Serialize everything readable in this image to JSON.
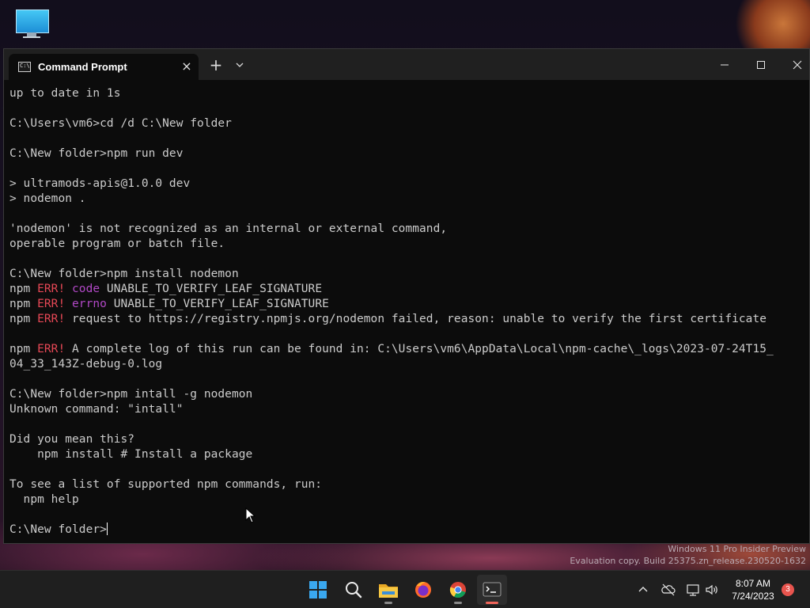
{
  "window": {
    "tab_title": "Command Prompt",
    "tab_icon_text": "C:\\",
    "close_tab_glyph": "×",
    "new_tab_glyph": "+",
    "minimize_glyph": "—",
    "maximize_glyph": "☐",
    "close_glyph": "✕"
  },
  "console": {
    "lines": [
      [
        {
          "text": "up to date in 1s"
        }
      ],
      [
        {
          "text": ""
        }
      ],
      [
        {
          "text": "C:\\Users\\vm6>cd /d C:\\New folder"
        }
      ],
      [
        {
          "text": ""
        }
      ],
      [
        {
          "text": "C:\\New folder>npm run dev"
        }
      ],
      [
        {
          "text": ""
        }
      ],
      [
        {
          "text": "> ultramods-apis@1.0.0 dev"
        }
      ],
      [
        {
          "text": "> nodemon ."
        }
      ],
      [
        {
          "text": ""
        }
      ],
      [
        {
          "text": "'nodemon' is not recognized as an internal or external command,"
        }
      ],
      [
        {
          "text": "operable program or batch file."
        }
      ],
      [
        {
          "text": ""
        }
      ],
      [
        {
          "text": "C:\\New folder>npm install nodemon"
        }
      ],
      [
        {
          "text": "npm "
        },
        {
          "text": "ERR!",
          "color": "red"
        },
        {
          "text": " "
        },
        {
          "text": "code",
          "color": "magenta"
        },
        {
          "text": " UNABLE_TO_VERIFY_LEAF_SIGNATURE"
        }
      ],
      [
        {
          "text": "npm "
        },
        {
          "text": "ERR!",
          "color": "red"
        },
        {
          "text": " "
        },
        {
          "text": "errno",
          "color": "magenta"
        },
        {
          "text": " UNABLE_TO_VERIFY_LEAF_SIGNATURE"
        }
      ],
      [
        {
          "text": "npm "
        },
        {
          "text": "ERR!",
          "color": "red"
        },
        {
          "text": " request to https://registry.npmjs.org/nodemon failed, reason: unable to verify the first certificate"
        }
      ],
      [
        {
          "text": ""
        }
      ],
      [
        {
          "text": "npm "
        },
        {
          "text": "ERR!",
          "color": "red"
        },
        {
          "text": " A complete log of this run can be found in: C:\\Users\\vm6\\AppData\\Local\\npm-cache\\_logs\\2023-07-24T15_"
        }
      ],
      [
        {
          "text": "04_33_143Z-debug-0.log"
        }
      ],
      [
        {
          "text": ""
        }
      ],
      [
        {
          "text": "C:\\New folder>npm intall -g nodemon"
        }
      ],
      [
        {
          "text": "Unknown command: \"intall\""
        }
      ],
      [
        {
          "text": ""
        }
      ],
      [
        {
          "text": "Did you mean this?"
        }
      ],
      [
        {
          "text": "    npm install # Install a package"
        }
      ],
      [
        {
          "text": ""
        }
      ],
      [
        {
          "text": "To see a list of supported npm commands, run:"
        }
      ],
      [
        {
          "text": "  npm help"
        }
      ],
      [
        {
          "text": ""
        }
      ],
      [
        {
          "text": "C:\\New folder>"
        }
      ]
    ],
    "colors": {
      "red": "#e74856",
      "magenta": "#b148c6",
      "default": "#cccccc"
    }
  },
  "watermark": {
    "line1": "Windows 11 Pro Insider Preview",
    "line2": "Evaluation copy. Build 25375.zn_release.230520-1632"
  },
  "taskbar": {
    "apps": [
      {
        "name": "start",
        "icon": "windows-logo-icon"
      },
      {
        "name": "search",
        "icon": "search-icon"
      },
      {
        "name": "file-explorer",
        "icon": "folder-icon"
      },
      {
        "name": "firefox",
        "icon": "firefox-icon"
      },
      {
        "name": "chrome",
        "icon": "chrome-icon"
      },
      {
        "name": "terminal",
        "icon": "terminal-icon"
      }
    ],
    "time": "8:07 AM",
    "date": "7/24/2023",
    "notification_count": "3",
    "chevron_glyph": "^"
  }
}
